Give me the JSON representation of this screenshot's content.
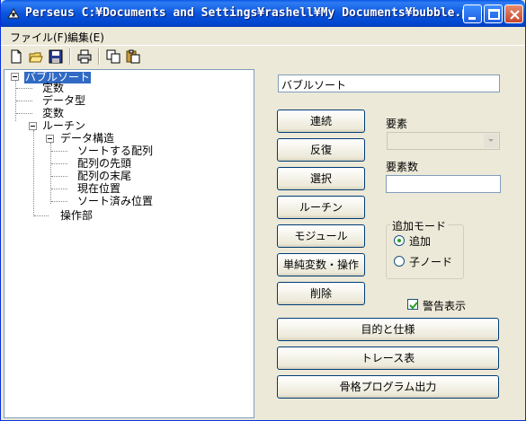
{
  "window": {
    "title": "Perseus C:¥Documents and Settings¥rashell¥My Documents¥bubble.prs"
  },
  "menu": {
    "file": "ファイル(F)",
    "edit": "編集(E)"
  },
  "toolbar": {
    "icons": [
      "new-file-icon",
      "open-folder-icon",
      "save-icon",
      "print-icon",
      "copy-icon",
      "paste-icon"
    ]
  },
  "tree": {
    "root": "バブルソート",
    "items": [
      "定数",
      "データ型",
      "変数",
      "ルーチン",
      "データ構造",
      "ソートする配列",
      "配列の先頭",
      "配列の末尾",
      "現在位置",
      "ソート済み位置",
      "操作部"
    ]
  },
  "name_field": {
    "value": "バブルソート"
  },
  "buttons": {
    "renzoku": "連続",
    "hanpuku": "反復",
    "sentaku": "選択",
    "routine": "ルーチン",
    "module": "モジュール",
    "simple_var": "単純変数・操作",
    "delete": "削除",
    "purpose": "目的と仕様",
    "trace": "トレース表",
    "skeleton": "骨格プログラム出力"
  },
  "element": {
    "label": "要素",
    "value": ""
  },
  "element_count": {
    "label": "要素数",
    "value": ""
  },
  "add_mode": {
    "title": "追加モード",
    "options": [
      "追加",
      "子ノード"
    ],
    "selected": "追加"
  },
  "warning": {
    "label": "警告表示",
    "checked": true
  },
  "colors": {
    "titlebar": "#0a55dd",
    "selection": "#316ac5",
    "face": "#ece9d8"
  }
}
